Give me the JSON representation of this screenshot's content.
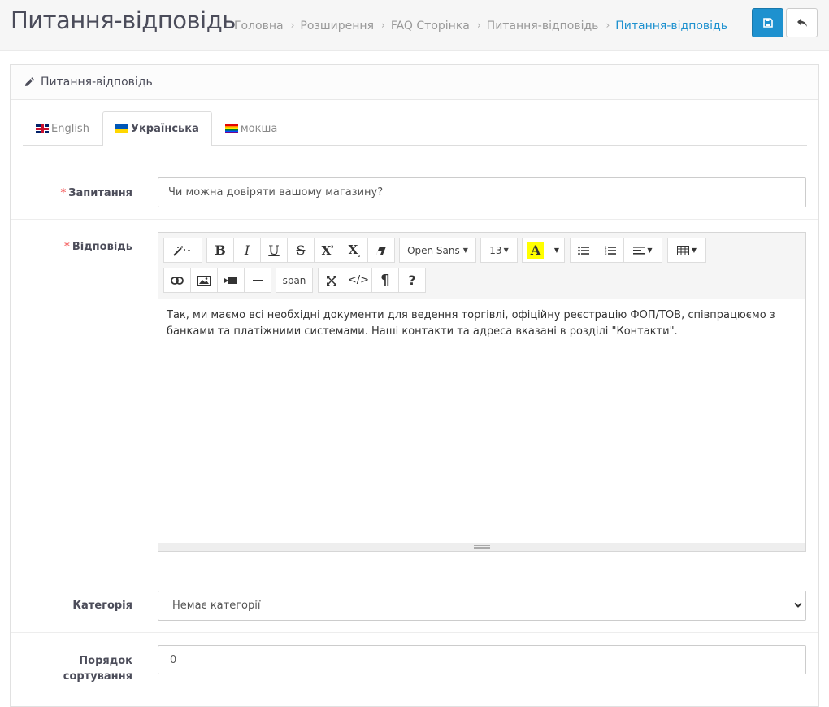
{
  "header": {
    "title": "Питання-відповідь",
    "breadcrumb": [
      "Головна",
      "Розширення",
      "FAQ Сторінка",
      "Питання-відповідь",
      "Питання-відповідь"
    ]
  },
  "panel": {
    "heading": "Питання-відповідь"
  },
  "tabs": [
    {
      "label": "English",
      "flag": "gb"
    },
    {
      "label": "Українська",
      "flag": "ua",
      "active": true
    },
    {
      "label": "мокша",
      "flag": "rainbow"
    }
  ],
  "form": {
    "question_label": "Запитання",
    "question_value": "Чи можна довіряти вашому магазину?",
    "answer_label": "Відповідь",
    "answer_text": "Так, ми маємо всі необхідні документи для ведення торгівлі, офіційну реєстрацію ФОП/ТОВ, співпрацюємо з банками та платіжними системами. Наші контакти та адреса вказані в розділі \"Контакти\".",
    "category_label": "Категорія",
    "category_value": "Немає категорії",
    "sort_label_line1": "Порядок",
    "sort_label_line2": "сортування",
    "sort_value": "0"
  },
  "editor": {
    "font_name": "Open Sans",
    "font_size": "13",
    "style_tag": "span"
  },
  "colors": {
    "primary": "#1e91cf",
    "required": "#f56b6b",
    "highlight": "#ffff00"
  }
}
